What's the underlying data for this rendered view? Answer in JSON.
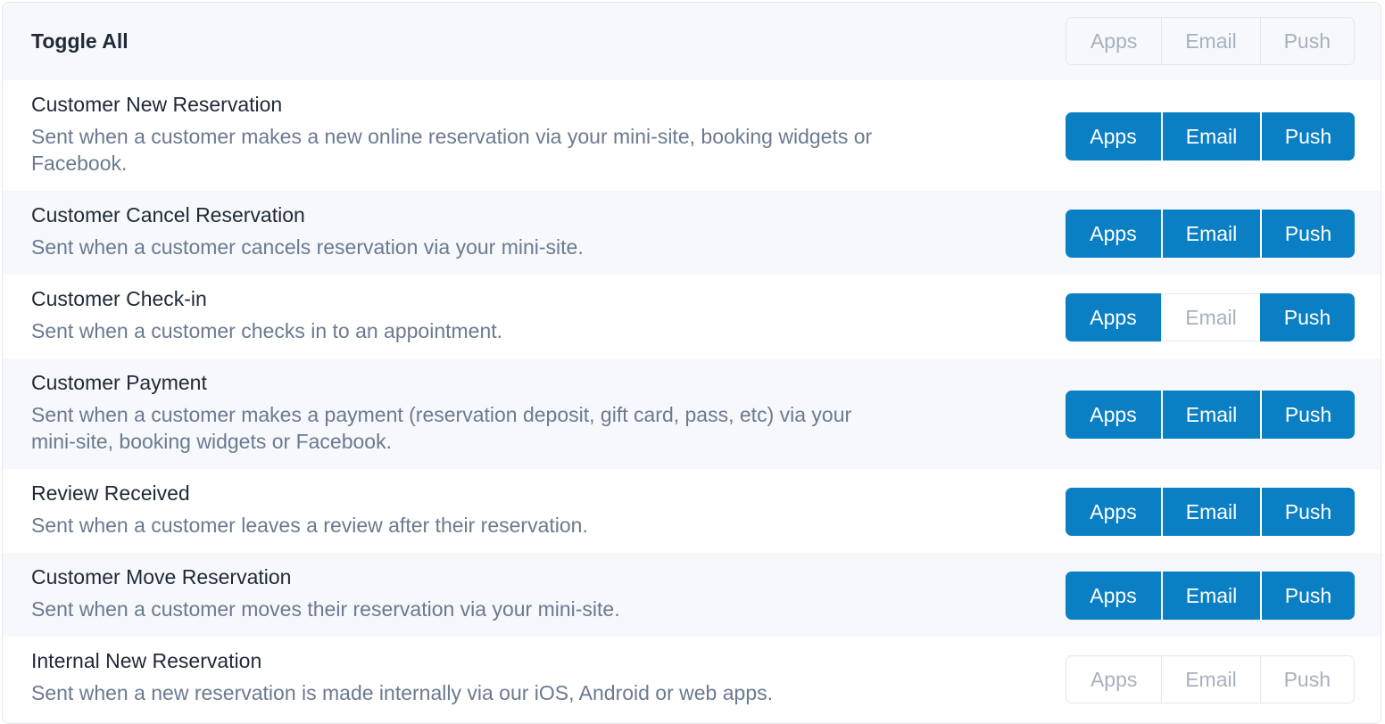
{
  "header": {
    "label": "Toggle All",
    "buttons": [
      {
        "label": "Apps",
        "active": false
      },
      {
        "label": "Email",
        "active": false
      },
      {
        "label": "Push",
        "active": false
      }
    ]
  },
  "rows": [
    {
      "title": "Customer New Reservation",
      "description": "Sent when a customer makes a new online reservation via your mini-site, booking widgets or Facebook.",
      "buttons": [
        {
          "label": "Apps",
          "active": true
        },
        {
          "label": "Email",
          "active": true
        },
        {
          "label": "Push",
          "active": true
        }
      ]
    },
    {
      "title": "Customer Cancel Reservation",
      "description": "Sent when a customer cancels reservation via your mini-site.",
      "buttons": [
        {
          "label": "Apps",
          "active": true
        },
        {
          "label": "Email",
          "active": true
        },
        {
          "label": "Push",
          "active": true
        }
      ]
    },
    {
      "title": "Customer Check-in",
      "description": "Sent when a customer checks in to an appointment.",
      "buttons": [
        {
          "label": "Apps",
          "active": true
        },
        {
          "label": "Email",
          "active": false
        },
        {
          "label": "Push",
          "active": true
        }
      ]
    },
    {
      "title": "Customer Payment",
      "description": "Sent when a customer makes a payment (reservation deposit, gift card, pass, etc) via your mini-site, booking widgets or Facebook.",
      "buttons": [
        {
          "label": "Apps",
          "active": true
        },
        {
          "label": "Email",
          "active": true
        },
        {
          "label": "Push",
          "active": true
        }
      ]
    },
    {
      "title": "Review Received",
      "description": "Sent when a customer leaves a review after their reservation.",
      "buttons": [
        {
          "label": "Apps",
          "active": true
        },
        {
          "label": "Email",
          "active": true
        },
        {
          "label": "Push",
          "active": true
        }
      ]
    },
    {
      "title": "Customer Move Reservation",
      "description": "Sent when a customer moves their reservation via your mini-site.",
      "buttons": [
        {
          "label": "Apps",
          "active": true
        },
        {
          "label": "Email",
          "active": true
        },
        {
          "label": "Push",
          "active": true
        }
      ]
    },
    {
      "title": "Internal New Reservation",
      "description": "Sent when a new reservation is made internally via our iOS, Android or web apps.",
      "buttons": [
        {
          "label": "Apps",
          "active": false
        },
        {
          "label": "Email",
          "active": false
        },
        {
          "label": "Push",
          "active": false
        }
      ]
    }
  ],
  "colors": {
    "active": "#0a7fc4",
    "inactive_text": "#a7b1bf",
    "title_text": "#1f2937",
    "desc_text": "#6b7a90",
    "alt_row": "#f6f8fb"
  }
}
